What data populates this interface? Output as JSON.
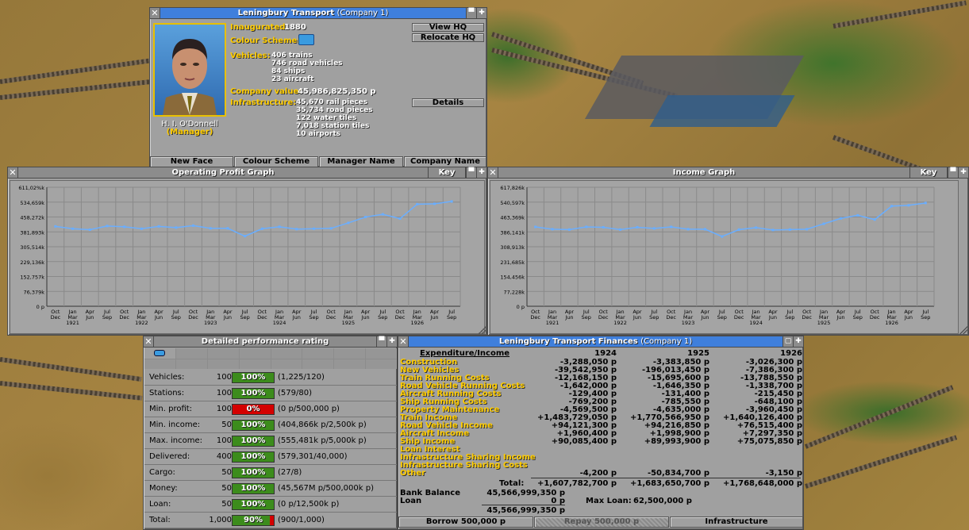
{
  "company_window": {
    "title": "Leningbury Transport",
    "title_suffix": "(Company 1)",
    "inaugurated_label": "Inaugurated:",
    "inaugurated": "1880",
    "colour_scheme_label": "Colour Scheme:",
    "vehicles_label": "Vehicles:",
    "vehicles": [
      "406 trains",
      "746 road vehicles",
      "84 ships",
      "23 aircraft"
    ],
    "company_value_label": "Company value:",
    "company_value": "45,986,825,350 p",
    "infrastructure_label": "Infrastructure:",
    "infrastructure": [
      "45,670 rail pieces",
      "35,734 road pieces",
      "122 water tiles",
      "7,018 station tiles",
      "10 airports"
    ],
    "manager_name": "H. I. O'Donnell",
    "manager_role": "(Manager)",
    "buttons": {
      "view_hq": "View HQ",
      "relocate_hq": "Relocate HQ",
      "details": "Details",
      "new_face": "New Face",
      "colour_scheme": "Colour Scheme",
      "manager_name": "Manager Name",
      "company_name": "Company Name"
    }
  },
  "profit_graph": {
    "title": "Operating Profit Graph",
    "key_label": "Key"
  },
  "income_graph": {
    "title": "Income Graph",
    "key_label": "Key"
  },
  "chart_data": [
    {
      "type": "line",
      "title": "Operating Profit Graph",
      "yticks": [
        "611,02%k",
        "534,659k",
        "458,272k",
        "381,893k",
        "305,514k",
        "229,136k",
        "152,757k",
        "76,379k",
        "0 p"
      ],
      "ylim": [
        0,
        611020
      ],
      "xticks": [
        [
          "Oct",
          "Dec",
          ""
        ],
        [
          "Jan",
          "Mar",
          "1921"
        ],
        [
          "Apr",
          "Jun",
          ""
        ],
        [
          "Jul",
          "Sep",
          ""
        ],
        [
          "Oct",
          "Dec",
          ""
        ],
        [
          "Jan",
          "Mar",
          "1922"
        ],
        [
          "Apr",
          "Jun",
          ""
        ],
        [
          "Jul",
          "Sep",
          ""
        ],
        [
          "Oct",
          "Dec",
          ""
        ],
        [
          "Jan",
          "Mar",
          "1923"
        ],
        [
          "Apr",
          "Jun",
          ""
        ],
        [
          "Jul",
          "Sep",
          ""
        ],
        [
          "Oct",
          "Dec",
          ""
        ],
        [
          "Jan",
          "Mar",
          "1924"
        ],
        [
          "Apr",
          "Jun",
          ""
        ],
        [
          "Jul",
          "Sep",
          ""
        ],
        [
          "Oct",
          "Dec",
          ""
        ],
        [
          "Jan",
          "Mar",
          "1925"
        ],
        [
          "Apr",
          "Jun",
          ""
        ],
        [
          "Jul",
          "Sep",
          ""
        ],
        [
          "Oct",
          "Dec",
          ""
        ],
        [
          "Jan",
          "Mar",
          "1926"
        ],
        [
          "Apr",
          "Jun",
          ""
        ],
        [
          "Jul",
          "Sep",
          ""
        ]
      ],
      "values": [
        410000,
        398000,
        393000,
        412000,
        408000,
        398000,
        410000,
        404000,
        414000,
        400000,
        400000,
        360000,
        398000,
        408000,
        396000,
        398000,
        400000,
        428000,
        458000,
        472000,
        450000,
        524000,
        526000,
        538000
      ]
    },
    {
      "type": "line",
      "title": "Income Graph",
      "yticks": [
        "617,826k",
        "540,597k",
        "463,369k",
        "386,141k",
        "308,913k",
        "231,685k",
        "154,456k",
        "77,228k",
        "0 p"
      ],
      "ylim": [
        0,
        617826
      ],
      "xticks": [
        [
          "Oct",
          "Dec",
          ""
        ],
        [
          "Jan",
          "Mar",
          "1921"
        ],
        [
          "Apr",
          "Jun",
          ""
        ],
        [
          "Jul",
          "Sep",
          ""
        ],
        [
          "Oct",
          "Dec",
          ""
        ],
        [
          "Jan",
          "Mar",
          "1922"
        ],
        [
          "Apr",
          "Jun",
          ""
        ],
        [
          "Jul",
          "Sep",
          ""
        ],
        [
          "Oct",
          "Dec",
          ""
        ],
        [
          "Jan",
          "Mar",
          "1923"
        ],
        [
          "Apr",
          "Jun",
          ""
        ],
        [
          "Jul",
          "Sep",
          ""
        ],
        [
          "Oct",
          "Dec",
          ""
        ],
        [
          "Jan",
          "Mar",
          "1924"
        ],
        [
          "Apr",
          "Jun",
          ""
        ],
        [
          "Jul",
          "Sep",
          ""
        ],
        [
          "Oct",
          "Dec",
          ""
        ],
        [
          "Jan",
          "Mar",
          "1925"
        ],
        [
          "Apr",
          "Jun",
          ""
        ],
        [
          "Jul",
          "Sep",
          ""
        ],
        [
          "Oct",
          "Dec",
          ""
        ],
        [
          "Jan",
          "Mar",
          "1926"
        ],
        [
          "Apr",
          "Jun",
          ""
        ],
        [
          "Jul",
          "Sep",
          ""
        ]
      ],
      "values": [
        412000,
        400000,
        398000,
        412000,
        410000,
        398000,
        410000,
        404000,
        412000,
        400000,
        400000,
        362000,
        398000,
        408000,
        396000,
        398000,
        400000,
        428000,
        456000,
        472000,
        450000,
        520000,
        524000,
        536000
      ]
    }
  ],
  "rating_window": {
    "title": "Detailed performance rating",
    "rows": [
      {
        "label": "Vehicles:",
        "value": "100",
        "pct": "100%",
        "fill": 1.0,
        "color": "#3c8c1c",
        "detail": "(1,225/120)"
      },
      {
        "label": "Stations:",
        "value": "100",
        "pct": "100%",
        "fill": 1.0,
        "color": "#3c8c1c",
        "detail": "(579/80)"
      },
      {
        "label": "Min. profit:",
        "value": "100",
        "pct": "0%",
        "fill": 1.0,
        "color": "#d40000",
        "detail": "(0 p/500,000 p)"
      },
      {
        "label": "Min. income:",
        "value": "50",
        "pct": "100%",
        "fill": 1.0,
        "color": "#3c8c1c",
        "detail": "(404,866k p/2,500k p)"
      },
      {
        "label": "Max. income:",
        "value": "100",
        "pct": "100%",
        "fill": 1.0,
        "color": "#3c8c1c",
        "detail": "(555,481k p/5,000k p)"
      },
      {
        "label": "Delivered:",
        "value": "400",
        "pct": "100%",
        "fill": 1.0,
        "color": "#3c8c1c",
        "detail": "(579,301/40,000)"
      },
      {
        "label": "Cargo:",
        "value": "50",
        "pct": "100%",
        "fill": 1.0,
        "color": "#3c8c1c",
        "detail": "(27/8)"
      },
      {
        "label": "Money:",
        "value": "50",
        "pct": "100%",
        "fill": 1.0,
        "color": "#3c8c1c",
        "detail": "(45,567M p/500,000k p)"
      },
      {
        "label": "Loan:",
        "value": "50",
        "pct": "100%",
        "fill": 1.0,
        "color": "#3c8c1c",
        "detail": "(0 p/12,500k p)"
      },
      {
        "label": "Total:",
        "value": "1,000",
        "pct": "90%",
        "fill": 0.9,
        "color": "#3c8c1c",
        "detail": "(900/1,000)"
      }
    ]
  },
  "finance_window": {
    "title": "Leningbury Transport Finances",
    "title_suffix": "(Company 1)",
    "header": "Expenditure/Income",
    "years": [
      "1924",
      "1925",
      "1926"
    ],
    "rows": [
      {
        "label": "Construction",
        "v": [
          "-3,288,050 p",
          "-3,383,850 p",
          "-3,026,300 p"
        ]
      },
      {
        "label": "New Vehicles",
        "v": [
          "-39,542,950 p",
          "-196,013,450 p",
          "-7,386,300 p"
        ]
      },
      {
        "label": "Train Running Costs",
        "v": [
          "-12,168,150 p",
          "-15,695,600 p",
          "-13,788,550 p"
        ]
      },
      {
        "label": "Road Vehicle Running Costs",
        "v": [
          "-1,642,000 p",
          "-1,646,350 p",
          "-1,338,700 p"
        ]
      },
      {
        "label": "Aircraft Running Costs",
        "v": [
          "-129,400 p",
          "-131,400 p",
          "-215,450 p"
        ]
      },
      {
        "label": "Ship Running Costs",
        "v": [
          "-769,200 p",
          "-785,550 p",
          "-648,100 p"
        ]
      },
      {
        "label": "Property Maintenance",
        "v": [
          "-4,569,500 p",
          "-4,635,000 p",
          "-3,960,450 p"
        ]
      },
      {
        "label": "Train Income",
        "v": [
          "+1,483,729,050 p",
          "+1,770,566,950 p",
          "+1,640,126,400 p"
        ]
      },
      {
        "label": "Road Vehicle Income",
        "v": [
          "+94,121,300 p",
          "+94,216,850 p",
          "+76,515,400 p"
        ]
      },
      {
        "label": "Aircraft Income",
        "v": [
          "+1,960,400 p",
          "+1,998,900 p",
          "+7,297,350 p"
        ]
      },
      {
        "label": "Ship Income",
        "v": [
          "+90,085,400 p",
          "+89,993,900 p",
          "+75,075,850 p"
        ]
      },
      {
        "label": "Loan Interest",
        "v": [
          "",
          "",
          ""
        ]
      },
      {
        "label": "Infrastructure Sharing Income",
        "v": [
          "",
          "",
          ""
        ]
      },
      {
        "label": "Infrastructure Sharing Costs",
        "v": [
          "",
          "",
          ""
        ]
      },
      {
        "label": "Other",
        "v": [
          "-4,200 p",
          "-50,834,700 p",
          "-3,150 p"
        ]
      }
    ],
    "total_label": "Total:",
    "totals": [
      "+1,607,782,700 p",
      "+1,683,650,700 p",
      "+1,768,648,000 p"
    ],
    "bank_balance_label": "Bank Balance",
    "bank_balance": "45,566,999,350 p",
    "loan_label": "Loan",
    "loan": "0 p",
    "net": "45,566,999,350 p",
    "max_loan_label": "Max Loan:",
    "max_loan": "62,500,000 p",
    "buttons": {
      "borrow": "Borrow 500,000 p",
      "repay": "Repay 500,000 p",
      "infrastructure": "Infrastructure"
    }
  },
  "colors": {
    "window": "#a0a0a0",
    "title_bar": "#8c8c8c",
    "active_title": "#3f7fdc",
    "label_yellow": "#ffcc00",
    "graph_line": "#6aaeff",
    "good": "#3c8c1c",
    "bad": "#d40000"
  }
}
